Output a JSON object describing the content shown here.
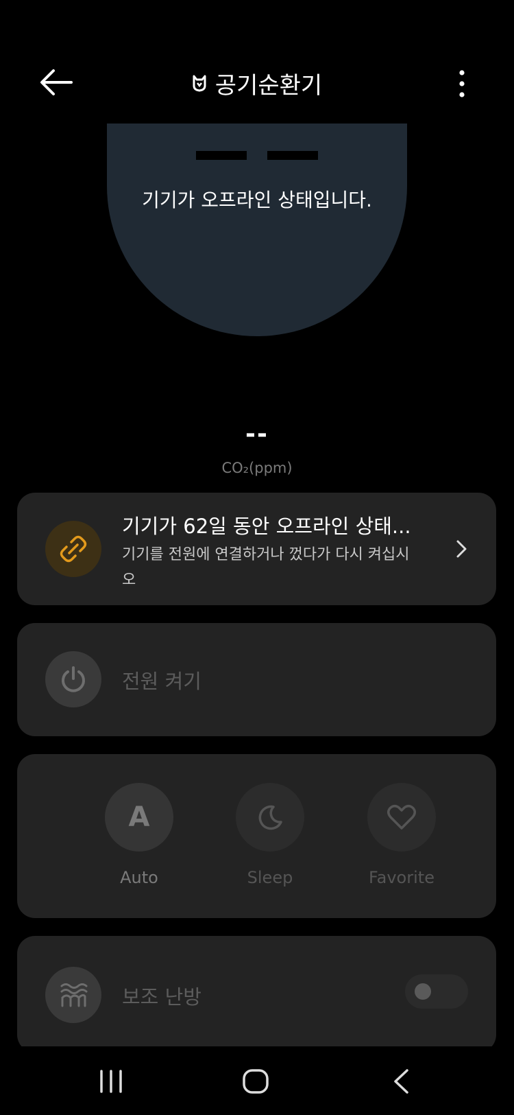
{
  "header": {
    "title": "공기순환기",
    "back_icon": "arrow-left-icon",
    "brand_icon": "mi-logo-icon",
    "menu_icon": "kebab-menu-icon"
  },
  "gauge": {
    "offline_message": "기기가 오프라인 상태입니다."
  },
  "co2": {
    "value": "--",
    "unit": "CO₂(ppm)"
  },
  "offline_card": {
    "icon": "broken-link-icon",
    "accent_color": "#e39a1c",
    "title": "기기가 62일 동안 오프라인 상태...",
    "description": "기기를 전원에 연결하거나 껐다가 다시 켜십시오"
  },
  "power_card": {
    "icon": "power-icon",
    "label": "전원 켜기"
  },
  "modes": [
    {
      "label": "Auto",
      "icon": "letter-a-icon",
      "glyph": "A"
    },
    {
      "label": "Sleep",
      "icon": "moon-icon"
    },
    {
      "label": "Favorite",
      "icon": "heart-icon"
    }
  ],
  "heat_card": {
    "icon": "heater-waves-icon",
    "label": "보조 난방",
    "toggle_on": false
  },
  "navbar": {
    "recent_icon": "recent-apps-icon",
    "home_icon": "home-icon",
    "back_icon": "back-chevron-icon"
  }
}
